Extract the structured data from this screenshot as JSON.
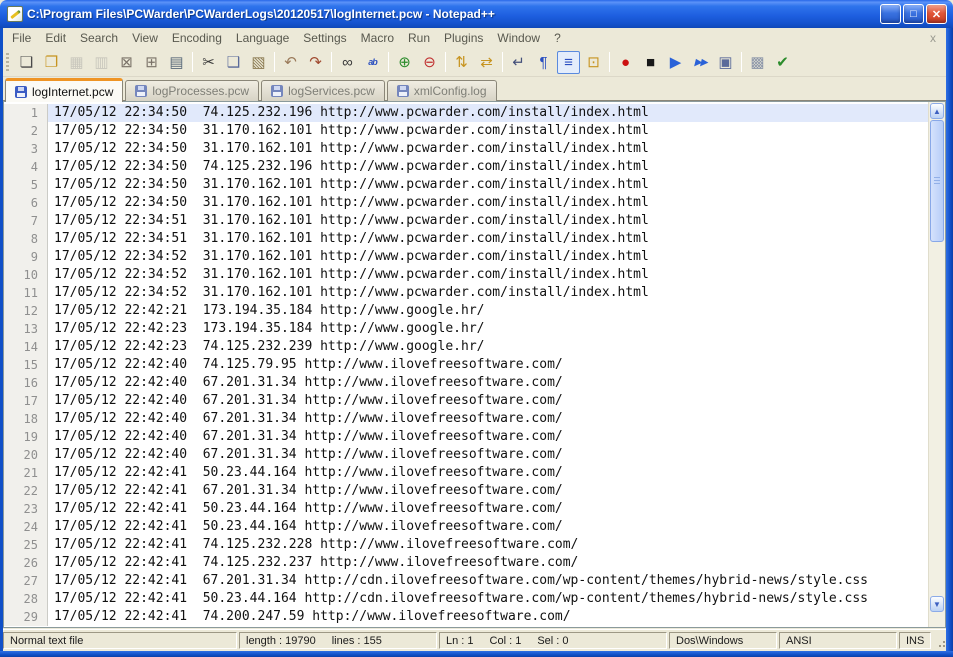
{
  "window": {
    "title": "C:\\Program Files\\PCWarder\\PCWarderLogs\\20120517\\logInternet.pcw - Notepad++",
    "controls": {
      "minimize": "_",
      "maximize": "□",
      "close": "✕"
    }
  },
  "menu": {
    "items": [
      "File",
      "Edit",
      "Search",
      "View",
      "Encoding",
      "Language",
      "Settings",
      "Macro",
      "Run",
      "Plugins",
      "Window",
      "?"
    ],
    "close_glyph": "x"
  },
  "toolbar": {
    "groups": [
      [
        {
          "name": "new-file-button",
          "icon": "new-file-icon",
          "glyph": "❏",
          "color": "#4a4a4a"
        },
        {
          "name": "open-file-button",
          "icon": "open-folder-icon",
          "glyph": "❐",
          "color": "#c79420"
        },
        {
          "name": "save-button",
          "icon": "save-icon",
          "glyph": "▦",
          "color": "#8a94a8",
          "disabled": true
        },
        {
          "name": "save-all-button",
          "icon": "save-all-icon",
          "glyph": "▥",
          "color": "#8a94a8",
          "disabled": true
        },
        {
          "name": "close-doc-button",
          "icon": "close-doc-icon",
          "glyph": "⊠",
          "color": "#7a7268"
        },
        {
          "name": "close-all-button",
          "icon": "close-all-icon",
          "glyph": "⊞",
          "color": "#7a7268"
        },
        {
          "name": "print-button",
          "icon": "printer-icon",
          "glyph": "▤",
          "color": "#5a6a7a"
        }
      ],
      [
        {
          "name": "cut-button",
          "icon": "scissors-icon",
          "glyph": "✂",
          "color": "#3a3a3a"
        },
        {
          "name": "copy-button",
          "icon": "copy-icon",
          "glyph": "❑",
          "color": "#5a6a9a"
        },
        {
          "name": "paste-button",
          "icon": "clipboard-icon",
          "glyph": "▧",
          "color": "#8a7a50"
        }
      ],
      [
        {
          "name": "undo-button",
          "icon": "undo-arrow-icon",
          "glyph": "↶",
          "color": "#9a7a5a"
        },
        {
          "name": "redo-button",
          "icon": "redo-arrow-icon",
          "glyph": "↷",
          "color": "#a04a30"
        }
      ],
      [
        {
          "name": "find-button",
          "icon": "binoculars-icon",
          "glyph": "∞",
          "color": "#3a3a3a"
        },
        {
          "name": "replace-button",
          "icon": "replace-icon",
          "glyph": "ab",
          "color": "#2a4fc0"
        }
      ],
      [
        {
          "name": "zoom-in-button",
          "icon": "zoom-in-icon",
          "glyph": "⊕",
          "color": "#2c8c2c"
        },
        {
          "name": "zoom-out-button",
          "icon": "zoom-out-icon",
          "glyph": "⊖",
          "color": "#c03030"
        }
      ],
      [
        {
          "name": "sync-vertical-scroll-button",
          "icon": "sync-v-icon",
          "glyph": "⇅",
          "color": "#c79420"
        },
        {
          "name": "sync-horizontal-scroll-button",
          "icon": "sync-h-icon",
          "glyph": "⇄",
          "color": "#c79420"
        }
      ],
      [
        {
          "name": "word-wrap-button",
          "icon": "word-wrap-icon",
          "glyph": "↵",
          "color": "#44507a"
        },
        {
          "name": "show-all-chars-button",
          "icon": "pilcrow-icon",
          "glyph": "¶",
          "color": "#2a4fc0"
        },
        {
          "name": "indent-guide-button",
          "icon": "indent-guide-icon",
          "glyph": "≡",
          "color": "#2a4fc0",
          "pressed": true
        },
        {
          "name": "user-define-dialog-button",
          "icon": "user-dialog-icon",
          "glyph": "⊡",
          "color": "#c79420"
        }
      ],
      [
        {
          "name": "macro-record-button",
          "icon": "record-dot-icon",
          "glyph": "●",
          "color": "#cc1111"
        },
        {
          "name": "macro-stop-button",
          "icon": "stop-square-icon",
          "glyph": "■",
          "color": "#181818"
        },
        {
          "name": "macro-play-button",
          "icon": "play-icon",
          "glyph": "▶",
          "color": "#2a62d8"
        },
        {
          "name": "macro-run-multiple-button",
          "icon": "fast-forward-icon",
          "glyph": "▶▶",
          "color": "#2a62d8"
        },
        {
          "name": "macro-save-button",
          "icon": "save-macro-icon",
          "glyph": "▣",
          "color": "#5a6a9a"
        }
      ],
      [
        {
          "name": "plugin-doc-button",
          "icon": "plugin-doc-icon",
          "glyph": "▩",
          "color": "#8a94a8"
        },
        {
          "name": "spell-check-button",
          "icon": "abc-check-icon",
          "glyph": "✔",
          "color": "#2c8c2c"
        }
      ]
    ]
  },
  "tabs": [
    {
      "label": "logInternet.pcw",
      "active": true
    },
    {
      "label": "logProcesses.pcw",
      "active": false
    },
    {
      "label": "logServices.pcw",
      "active": false
    },
    {
      "label": "xmlConfig.log",
      "active": false
    }
  ],
  "editor": {
    "current_line": 1,
    "lines": [
      {
        "date": "17/05/12",
        "time": "22:34:50",
        "ip": "74.125.232.196",
        "url": "http://www.pcwarder.com/install/index.html"
      },
      {
        "date": "17/05/12",
        "time": "22:34:50",
        "ip": "31.170.162.101",
        "url": "http://www.pcwarder.com/install/index.html"
      },
      {
        "date": "17/05/12",
        "time": "22:34:50",
        "ip": "31.170.162.101",
        "url": "http://www.pcwarder.com/install/index.html"
      },
      {
        "date": "17/05/12",
        "time": "22:34:50",
        "ip": "74.125.232.196",
        "url": "http://www.pcwarder.com/install/index.html"
      },
      {
        "date": "17/05/12",
        "time": "22:34:50",
        "ip": "31.170.162.101",
        "url": "http://www.pcwarder.com/install/index.html"
      },
      {
        "date": "17/05/12",
        "time": "22:34:50",
        "ip": "31.170.162.101",
        "url": "http://www.pcwarder.com/install/index.html"
      },
      {
        "date": "17/05/12",
        "time": "22:34:51",
        "ip": "31.170.162.101",
        "url": "http://www.pcwarder.com/install/index.html"
      },
      {
        "date": "17/05/12",
        "time": "22:34:51",
        "ip": "31.170.162.101",
        "url": "http://www.pcwarder.com/install/index.html"
      },
      {
        "date": "17/05/12",
        "time": "22:34:52",
        "ip": "31.170.162.101",
        "url": "http://www.pcwarder.com/install/index.html"
      },
      {
        "date": "17/05/12",
        "time": "22:34:52",
        "ip": "31.170.162.101",
        "url": "http://www.pcwarder.com/install/index.html"
      },
      {
        "date": "17/05/12",
        "time": "22:34:52",
        "ip": "31.170.162.101",
        "url": "http://www.pcwarder.com/install/index.html"
      },
      {
        "date": "17/05/12",
        "time": "22:42:21",
        "ip": "173.194.35.184",
        "url": "http://www.google.hr/"
      },
      {
        "date": "17/05/12",
        "time": "22:42:23",
        "ip": "173.194.35.184",
        "url": "http://www.google.hr/"
      },
      {
        "date": "17/05/12",
        "time": "22:42:23",
        "ip": "74.125.232.239",
        "url": "http://www.google.hr/"
      },
      {
        "date": "17/05/12",
        "time": "22:42:40",
        "ip": "74.125.79.95",
        "url": "http://www.ilovefreesoftware.com/"
      },
      {
        "date": "17/05/12",
        "time": "22:42:40",
        "ip": "67.201.31.34",
        "url": "http://www.ilovefreesoftware.com/"
      },
      {
        "date": "17/05/12",
        "time": "22:42:40",
        "ip": "67.201.31.34",
        "url": "http://www.ilovefreesoftware.com/"
      },
      {
        "date": "17/05/12",
        "time": "22:42:40",
        "ip": "67.201.31.34",
        "url": "http://www.ilovefreesoftware.com/"
      },
      {
        "date": "17/05/12",
        "time": "22:42:40",
        "ip": "67.201.31.34",
        "url": "http://www.ilovefreesoftware.com/"
      },
      {
        "date": "17/05/12",
        "time": "22:42:40",
        "ip": "67.201.31.34",
        "url": "http://www.ilovefreesoftware.com/"
      },
      {
        "date": "17/05/12",
        "time": "22:42:41",
        "ip": "50.23.44.164",
        "url": "http://www.ilovefreesoftware.com/"
      },
      {
        "date": "17/05/12",
        "time": "22:42:41",
        "ip": "67.201.31.34",
        "url": "http://www.ilovefreesoftware.com/"
      },
      {
        "date": "17/05/12",
        "time": "22:42:41",
        "ip": "50.23.44.164",
        "url": "http://www.ilovefreesoftware.com/"
      },
      {
        "date": "17/05/12",
        "time": "22:42:41",
        "ip": "50.23.44.164",
        "url": "http://www.ilovefreesoftware.com/"
      },
      {
        "date": "17/05/12",
        "time": "22:42:41",
        "ip": "74.125.232.228",
        "url": "http://www.ilovefreesoftware.com/"
      },
      {
        "date": "17/05/12",
        "time": "22:42:41",
        "ip": "74.125.232.237",
        "url": "http://www.ilovefreesoftware.com/"
      },
      {
        "date": "17/05/12",
        "time": "22:42:41",
        "ip": "67.201.31.34",
        "url": "http://cdn.ilovefreesoftware.com/wp-content/themes/hybrid-news/style.css"
      },
      {
        "date": "17/05/12",
        "time": "22:42:41",
        "ip": "50.23.44.164",
        "url": "http://cdn.ilovefreesoftware.com/wp-content/themes/hybrid-news/style.css"
      },
      {
        "date": "17/05/12",
        "time": "22:42:41",
        "ip": "74.200.247.59",
        "url": "http://www.ilovefreesoftware.com/"
      }
    ]
  },
  "scrollbar": {
    "up_glyph": "▲",
    "down_glyph": "▼"
  },
  "status": {
    "doc_type": "Normal text file",
    "length": "length : 19790",
    "lines": "lines : 155",
    "ln": "Ln : 1",
    "col": "Col : 1",
    "sel": "Sel : 0",
    "eol": "Dos\\Windows",
    "encoding": "ANSI",
    "mode": "INS"
  },
  "colors": {
    "titlebar_blue": "#1e5fe0",
    "chrome_beige": "#ece9d8",
    "active_tab_accent": "#ef9424",
    "current_line_highlight": "#e1e9fb",
    "frame_blue": "#1050c8"
  }
}
